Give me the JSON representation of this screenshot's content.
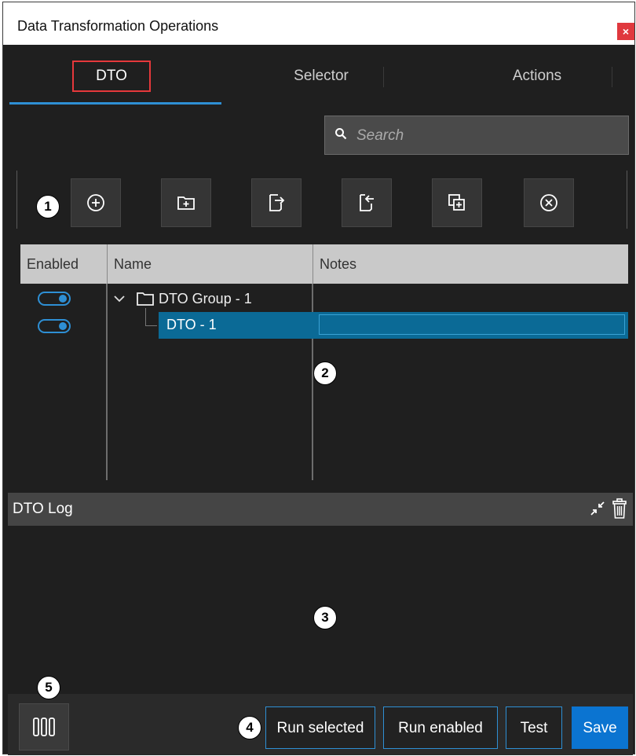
{
  "window": {
    "title": "Data Transformation Operations",
    "close_glyph": "×"
  },
  "tabs": [
    {
      "label": "DTO"
    },
    {
      "label": "Selector"
    },
    {
      "label": "Actions"
    }
  ],
  "search": {
    "placeholder": "Search",
    "value": ""
  },
  "toolbar": {
    "buttons": [
      {
        "icon": "add-circle-icon"
      },
      {
        "icon": "new-folder-icon"
      },
      {
        "icon": "export-icon"
      },
      {
        "icon": "import-icon"
      },
      {
        "icon": "duplicate-icon"
      },
      {
        "icon": "remove-circle-icon"
      }
    ]
  },
  "grid": {
    "columns": [
      "Enabled",
      "Name",
      "Notes"
    ],
    "rows": [
      {
        "enabled": true,
        "name": "DTO Group - 1",
        "type": "group",
        "notes": ""
      },
      {
        "enabled": true,
        "name": "DTO - 1",
        "type": "item",
        "notes": "",
        "selected": true
      }
    ]
  },
  "log": {
    "title": "DTO Log"
  },
  "callouts": [
    "1",
    "2",
    "3",
    "4",
    "5"
  ],
  "footer": {
    "run_selected": "Run selected",
    "run_enabled": "Run enabled",
    "test": "Test",
    "save": "Save"
  },
  "colors": {
    "accent": "#2e8fd4",
    "selected_row": "#0b6a96",
    "save": "#0b74d1",
    "highlight_box": "#e5383b"
  }
}
